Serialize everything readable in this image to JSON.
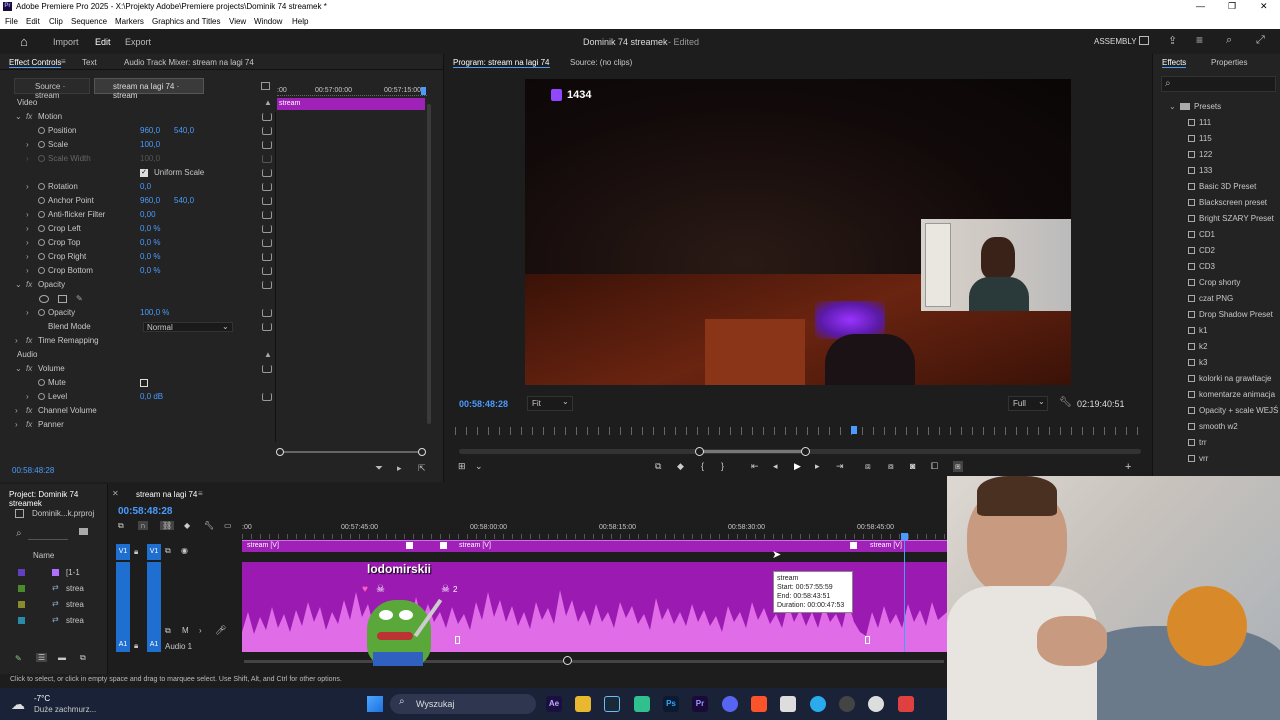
{
  "titlebar": {
    "app_title": "Adobe Premiere Pro 2025 - X:\\Projekty Adobe\\Premiere projects\\Dominik 74 streamek *",
    "minimize": "—",
    "maximize": "❐",
    "close": "✕"
  },
  "menu": [
    "File",
    "Edit",
    "Clip",
    "Sequence",
    "Markers",
    "Graphics and Titles",
    "View",
    "Window",
    "Help"
  ],
  "header": {
    "import": "Import",
    "edit": "Edit",
    "export": "Export",
    "project_title": "Dominik 74 streamek",
    "status": "- Edited",
    "workspace": "ASSEMBLY"
  },
  "effect_controls": {
    "tabs": [
      "Effect Controls",
      "Text",
      "Audio Track Mixer: stream na lagi 74"
    ],
    "source": "Source · stream",
    "clip": "stream na lagi 74 · stream",
    "ruler": {
      "t0": ":00",
      "t1": "00:57:00:00",
      "t2": "00:57:15:00"
    },
    "clip_bar": "stream",
    "video": "Video",
    "audio": "Audio",
    "current_time": "00:58:48:28",
    "motion": "Motion",
    "position_label": "Position",
    "position_x": "960,0",
    "position_y": "540,0",
    "scale_label": "Scale",
    "scale_val": "100,0",
    "scale_width_label": "Scale Width",
    "scale_width_val": "100,0",
    "uniform_scale": "Uniform Scale",
    "rotation_label": "Rotation",
    "rotation_val": "0,0",
    "anchor_label": "Anchor Point",
    "anchor_x": "960,0",
    "anchor_y": "540,0",
    "antiflicker_label": "Anti-flicker Filter",
    "antiflicker_val": "0,00",
    "crop_left": "Crop Left",
    "crop_left_val": "0,0 %",
    "crop_top": "Crop Top",
    "crop_top_val": "0,0 %",
    "crop_right": "Crop Right",
    "crop_right_val": "0,0 %",
    "crop_bottom": "Crop Bottom",
    "crop_bottom_val": "0,0 %",
    "opacity_group": "Opacity",
    "opacity_label": "Opacity",
    "opacity_val": "100,0 %",
    "blend_label": "Blend Mode",
    "blend_val": "Normal",
    "time_remap": "Time Remapping",
    "volume": "Volume",
    "mute": "Mute",
    "level_label": "Level",
    "level_val": "0,0 dB",
    "channel_volume": "Channel Volume",
    "panner": "Panner"
  },
  "program": {
    "tab": "Program: stream na lagi 74",
    "source_tab": "Source: (no clips)",
    "timecode": "00:58:48:28",
    "fit": "Fit",
    "quality": "Full",
    "duration": "02:19:40:51",
    "overlay_count": "1434"
  },
  "effects": {
    "tab": "Effects",
    "properties_tab": "Properties",
    "presets_folder": "Presets",
    "presets": [
      "111",
      "115",
      "122",
      "133",
      "Basic 3D Preset",
      "Blackscreen preset",
      "Bright SZARY Preset",
      "CD1",
      "CD2",
      "CD3",
      "Crop shorty",
      "czat PNG",
      "Drop Shadow Preset",
      "k1",
      "k2",
      "k3",
      "kolorki na grawitacje",
      "komentarze animacja",
      "Opacity + scale WEJŚ",
      "smooth w2",
      "trr",
      "vrr"
    ]
  },
  "project": {
    "tab": "Project: Dominik 74 streamek",
    "file": "Dominik...k.prproj",
    "name_header": "Name",
    "items": [
      "[1-1",
      "strea",
      "strea",
      "strea"
    ]
  },
  "timeline": {
    "tab": "stream na lagi 74",
    "timecode": "00:58:48:28",
    "ruler": [
      ":00",
      "00:57:45:00",
      "00:58:00:00",
      "00:58:15:00",
      "00:58:30:00",
      "00:58:45:00"
    ],
    "clip_a": "stream [V]",
    "clip_b": "stream [V]",
    "clip_c": "stream [V]",
    "v1": "V1",
    "a1": "A1",
    "audio1": "Audio 1",
    "tooltip": {
      "name": "stream",
      "start": "Start: 00:57:55:59",
      "end": "End: 00:58:43:51",
      "duration": "Duration: 00:00:47:53"
    }
  },
  "overlay": {
    "username": "lodomirskii",
    "count": "2"
  },
  "statusbar": "Click to select, or click in empty space and drag to marquee select. Use Shift, Alt, and Ctrl for other options.",
  "taskbar": {
    "temp": "-7°C",
    "weather": "Duże zachmurz...",
    "search": "Wyszukaj"
  },
  "colors": {
    "accent": "#4b9bff",
    "clip": "#a021b8",
    "audio_wave": "#e06ce8",
    "bg": "#1d1d1d"
  }
}
